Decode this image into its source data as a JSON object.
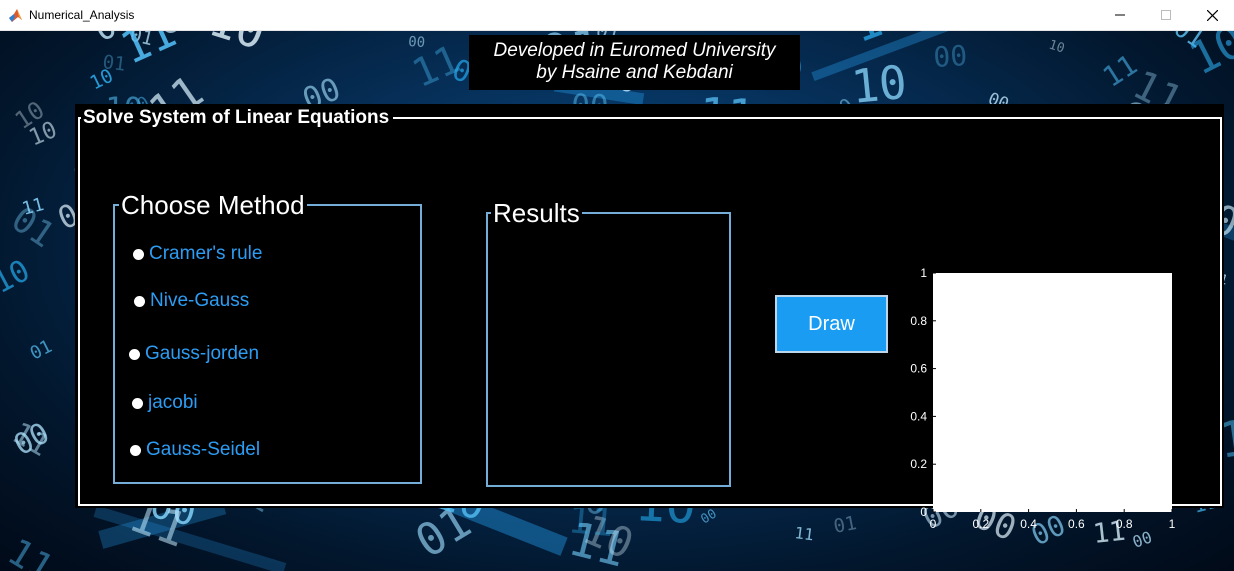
{
  "window": {
    "title": "Numerical_Analysis",
    "minimize_glyph": "–",
    "maximize_glyph": "☐",
    "close_glyph": "✕"
  },
  "credit": {
    "line1": "Developed in Euromed University",
    "line2": "by Hsaine and Kebdani"
  },
  "panel": {
    "title": "Solve System of Linear Equations"
  },
  "methods": {
    "title": "Choose Method",
    "options": [
      "Cramer's rule",
      "Nive-Gauss",
      "Gauss-jorden",
      "jacobi",
      "Gauss-Seidel"
    ]
  },
  "results": {
    "title": "Results"
  },
  "draw_button": {
    "label": "Draw"
  },
  "axes": {
    "x_ticks": [
      "0",
      "0.2",
      "0.4",
      "0.6",
      "0.8",
      "1"
    ],
    "y_ticks": [
      "0",
      "0.2",
      "0.4",
      "0.6",
      "0.8",
      "1"
    ],
    "xlim": [
      0,
      1
    ],
    "ylim": [
      0,
      1
    ],
    "background": "#ffffff"
  },
  "background_digits": [
    "1",
    "0",
    "1",
    "0",
    "1",
    "0",
    "0",
    "1",
    "0",
    "1",
    "1",
    "0",
    "1",
    "0",
    "1",
    "0",
    "0",
    "1",
    "0",
    "1",
    "1",
    "0",
    "0",
    "1",
    "0",
    "1",
    "0",
    "0",
    "1",
    "1",
    "0",
    "1",
    "0",
    "1",
    "1",
    "0",
    "1",
    "0",
    "0",
    "1"
  ],
  "colors": {
    "accent": "#1a9cf3",
    "option_text": "#2d9cf3",
    "frame_border": "#74aed8",
    "panel_bg": "#000000"
  }
}
